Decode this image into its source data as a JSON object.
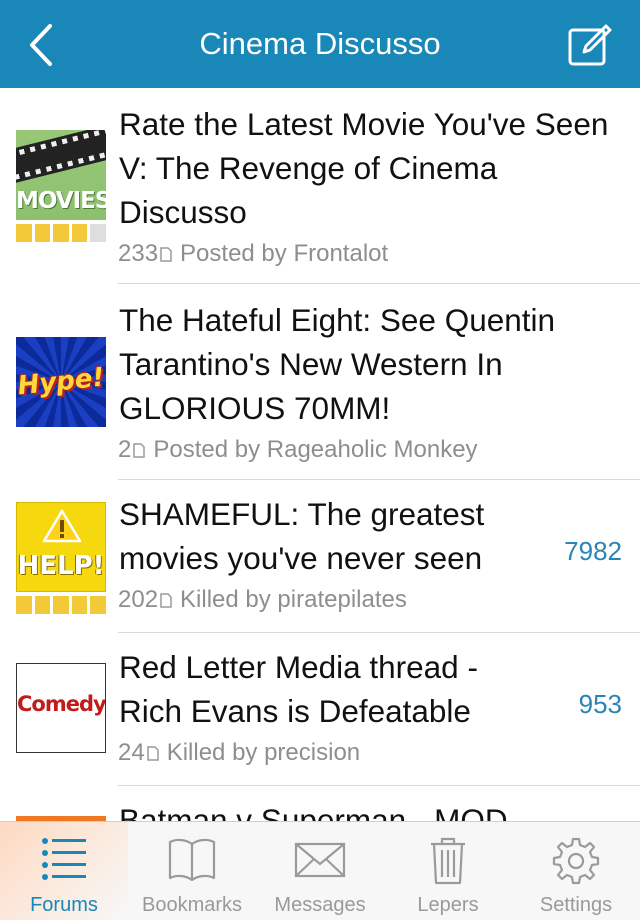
{
  "header": {
    "title": "Cinema Discusso"
  },
  "threads": [
    {
      "title": "Rate the Latest Movie You've Seen V: The Revenge of Cinema Discusso",
      "posts": "233",
      "byline": "Posted by Frontalot",
      "unread": "",
      "tag": "MOVIES",
      "tag_icon": "movies-tag-icon",
      "rating": 4
    },
    {
      "title": "The Hateful Eight: See Quentin Tarantino's New Western In GLORIOUS 70MM!",
      "posts": "2",
      "byline": "Posted by Rageaholic Monkey",
      "unread": "",
      "tag": "Hype!",
      "tag_icon": "hype-tag-icon",
      "rating": 0
    },
    {
      "title": "SHAMEFUL: The greatest movies you've never seen",
      "posts": "202",
      "byline": "Killed by piratepilates",
      "unread": "7982",
      "tag": "HELP!",
      "tag_icon": "help-tag-icon",
      "rating": 5
    },
    {
      "title": "Red Letter Media thread - Rich Evans is Defeatable",
      "posts": "24",
      "byline": "Killed by precision",
      "unread": "953",
      "tag": "Comedy",
      "tag_icon": "comedy-tag-icon",
      "rating": 0
    },
    {
      "title": "Batman v Superman - MOD",
      "posts": "",
      "byline": "",
      "unread": "",
      "tag": "",
      "tag_icon": "orange-tag-icon",
      "rating": 0
    }
  ],
  "tabbar": {
    "tabs": [
      {
        "label": "Forums",
        "icon": "forums-list-icon",
        "active": true
      },
      {
        "label": "Bookmarks",
        "icon": "book-icon",
        "active": false
      },
      {
        "label": "Messages",
        "icon": "envelope-icon",
        "active": false
      },
      {
        "label": "Lepers",
        "icon": "trash-icon",
        "active": false
      },
      {
        "label": "Settings",
        "icon": "gear-icon",
        "active": false
      }
    ]
  },
  "colors": {
    "header": "#1a87b9",
    "accent": "#1a87b9",
    "unread_count": "#2a84b8",
    "rating_on": "#f3c93a",
    "rating_off": "#dedede",
    "tab_inactive": "#9a9a9a"
  }
}
